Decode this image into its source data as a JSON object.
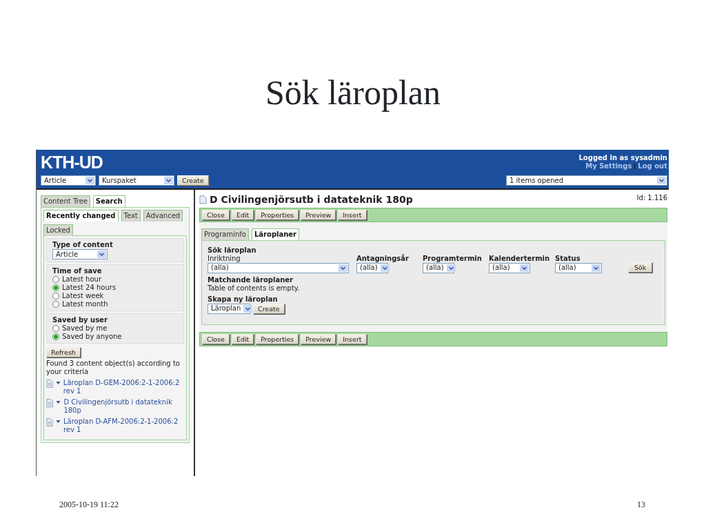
{
  "slide": {
    "title": "Sök läroplan",
    "date": "2005-10-19 11:22",
    "page": "13"
  },
  "app": {
    "logo": "KTH-UD",
    "type_select": "Article",
    "package_select": "Kurspaket",
    "create_button": "Create",
    "logged_in": "Logged in as sysadmin",
    "user_links": [
      "My Settings",
      "Log out"
    ],
    "opened_select": "1 items opened"
  },
  "left_tabs": [
    {
      "label": "Content Tree",
      "selected": false
    },
    {
      "label": "Search",
      "selected": true
    }
  ],
  "search_tabs": [
    {
      "label": "Recently changed",
      "selected": true
    },
    {
      "label": "Text",
      "selected": false
    },
    {
      "label": "Advanced",
      "selected": false
    },
    {
      "label": "Locked",
      "selected": false
    }
  ],
  "type_of_content": {
    "heading": "Type of content",
    "value": "Article"
  },
  "time_of_save": {
    "heading": "Time of save",
    "options": [
      {
        "label": "Latest hour",
        "selected": false
      },
      {
        "label": "Latest 24 hours",
        "selected": true
      },
      {
        "label": "Latest week",
        "selected": false
      },
      {
        "label": "Latest month",
        "selected": false
      }
    ]
  },
  "saved_by_user": {
    "heading": "Saved by user",
    "options": [
      {
        "label": "Saved by me",
        "selected": false
      },
      {
        "label": "Saved by anyone",
        "selected": true
      }
    ]
  },
  "refresh_button": "Refresh",
  "result_text": "Found 3 content object(s) according to your criteria",
  "results": [
    {
      "title": "Läroplan D-GEM-2006:2-1-2006:2 rev 1"
    },
    {
      "title": "D Civilingenjörsutb i datateknik 180p"
    },
    {
      "title": "Läroplan D-AFM-2006:2-1-2006:2 rev 1"
    }
  ],
  "document": {
    "title": "D Civilingenjörsutb i datateknik 180p",
    "id": "Id: 1.116",
    "toolbar_top": [
      "Close",
      "Edit",
      "Properties",
      "Preview",
      "Insert"
    ],
    "tabs": [
      {
        "label": "Programinfo",
        "selected": false
      },
      {
        "label": "Läroplaner",
        "selected": true
      }
    ],
    "search_heading": "Sök läroplan",
    "filters": [
      {
        "kind": "wide",
        "label": "Inriktning",
        "value": "(alla)"
      },
      {
        "kind": "narrow",
        "label": "Antagningsår",
        "value": "(alla)"
      },
      {
        "kind": "narrow",
        "label": "Programtermin",
        "value": "(alla)"
      },
      {
        "kind": "narrow",
        "label": "Kalendertermin",
        "value": "(alla)"
      },
      {
        "kind": "narrow",
        "label": "Status",
        "value": "(alla)"
      }
    ],
    "search_button": "Sök",
    "matches_heading": "Matchande läroplaner",
    "matches_text": "Table of contents is empty.",
    "create_heading": "Skapa ny läroplan",
    "create_select": "Läroplan",
    "create_button": "Create",
    "toolbar_bottom": [
      "Close",
      "Edit",
      "Properties",
      "Preview",
      "Insert"
    ]
  }
}
